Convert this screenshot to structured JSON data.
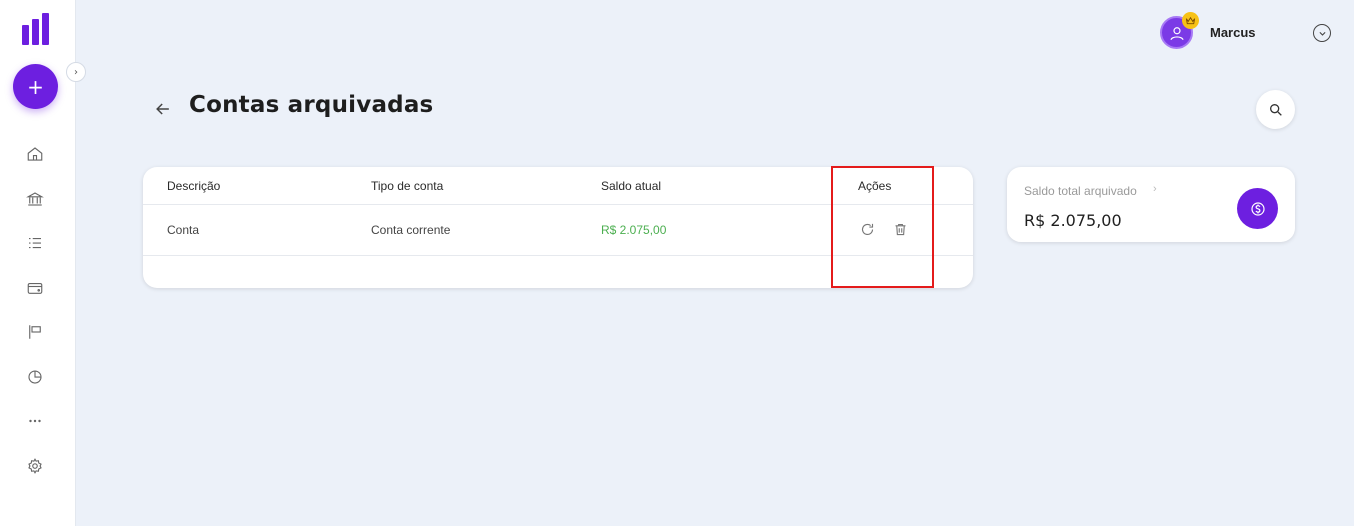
{
  "user": {
    "name": "Marcus"
  },
  "page": {
    "title": "Contas arquivadas"
  },
  "table": {
    "headers": [
      "Descrição",
      "Tipo de conta",
      "Saldo atual",
      "Ações"
    ],
    "rows": [
      {
        "description": "Conta",
        "type": "Conta corrente",
        "balance": "R$ 2.075,00"
      }
    ]
  },
  "summary": {
    "label": "Saldo total arquivado",
    "value": "R$ 2.075,00"
  },
  "colors": {
    "brand": "#6d1fe0",
    "positive": "#4caf50",
    "highlight": "#e41b1b",
    "background": "#ecf1f9"
  }
}
